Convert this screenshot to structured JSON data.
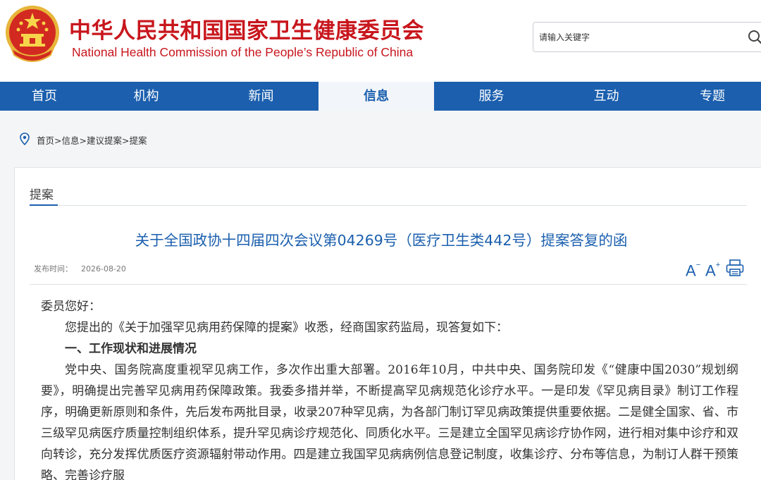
{
  "header": {
    "title_cn": "中华人民共和国国家卫生健康委员会",
    "title_en": "National Health Commission of the People’s Republic of China",
    "search_placeholder": "请输入关键字"
  },
  "nav": {
    "items": [
      {
        "label": "首页"
      },
      {
        "label": "机构"
      },
      {
        "label": "新闻"
      },
      {
        "label": "信息"
      },
      {
        "label": "服务"
      },
      {
        "label": "互动"
      },
      {
        "label": "专题"
      }
    ],
    "active": "信息"
  },
  "breadcrumb": {
    "items": [
      "首页",
      "信息",
      "建议提案",
      "提案"
    ],
    "separator": ">"
  },
  "section": {
    "label": "提案"
  },
  "article": {
    "title": "关于全国政协十四届四次会议第04269号（医疗卫生类442号）提案答复的函",
    "date_label": "发布时间：",
    "date": "2026-08-20",
    "font_larger": "A",
    "font_smaller": "A",
    "greeting": "委员您好：",
    "intro": "您提出的《关于加强罕见病用药保障的提案》收悉，经商国家药监局，现答复如下：",
    "heading1": "一、工作现状和进展情况",
    "paragraph1": "党中央、国务院高度重视罕见病工作，多次作出重大部署。2016年10月，中共中央、国务院印发《“健康中国2030”规划纲要》，明确提出完善罕见病用药保障政策。我委多措并举，不断提高罕见病规范化诊疗水平。一是印发《罕见病目录》制订工作程序，明确更新原则和条件，先后发布两批目录，收录207种罕见病，为各部门制订罕见病政策提供重要依据。二是健全国家、省、市三级罕见病医疗质量控制组织体系，提升罕见病诊疗规范化、同质化水平。三是建立全国罕见病诊疗协作网，进行相对集中诊疗和双向转诊，充分发挥优质医疗资源辐射带动作用。四是建立我国罕见病病例信息登记制度，收集诊疗、分布等信息，为制订人群干预策略、完善诊疗服"
  },
  "colors": {
    "brand_red": "#c8161d",
    "nav_blue": "#1b5fae",
    "title_blue": "#1b5fae"
  },
  "icons": {
    "emblem": "national-emblem-icon",
    "search": "search-icon",
    "location": "location-pin-icon",
    "print": "printer-icon"
  }
}
